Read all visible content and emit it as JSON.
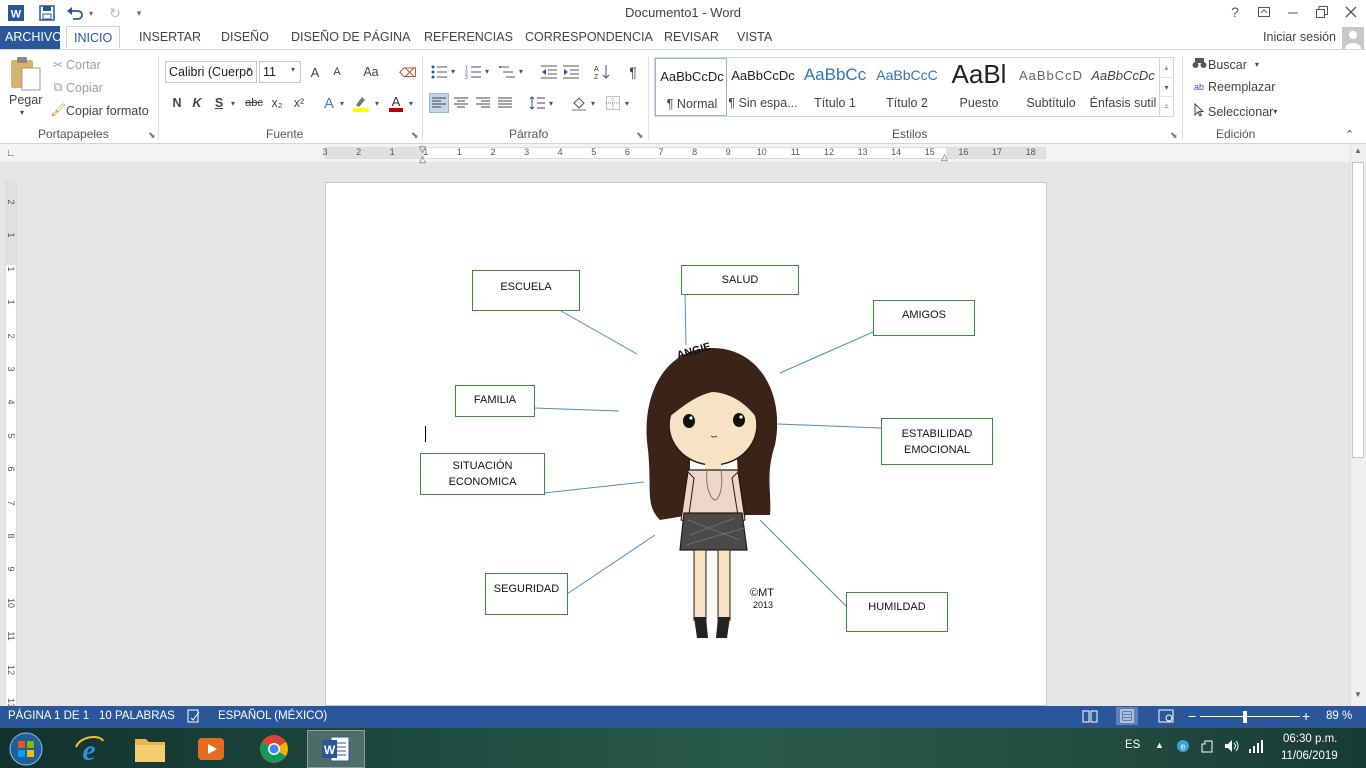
{
  "app": {
    "window_title": "Documento1 - Word"
  },
  "quick_access": {
    "word_icon": "word-app-icon",
    "save": "save-icon",
    "undo": "undo-icon",
    "redo": "redo-icon",
    "customize": "customize-qat-icon"
  },
  "window_controls": {
    "help": "?",
    "ribbon_display": "ribbon-display-icon",
    "minimize": "minimize-icon",
    "restore": "restore-icon",
    "close": "close-icon"
  },
  "tabs": [
    {
      "label": "ARCHIVO"
    },
    {
      "label": "INICIO"
    },
    {
      "label": "INSERTAR"
    },
    {
      "label": "DISEÑO"
    },
    {
      "label": "DISEÑO DE PÁGINA"
    },
    {
      "label": "REFERENCIAS"
    },
    {
      "label": "CORRESPONDENCIA"
    },
    {
      "label": "REVISAR"
    },
    {
      "label": "VISTA"
    }
  ],
  "signin": "Iniciar sesión",
  "clipboard": {
    "paste": "Pegar",
    "cut": "Cortar",
    "copy": "Copiar",
    "format_painter": "Copiar formato",
    "group": "Portapapeles"
  },
  "font": {
    "name": "Calibri (Cuerpo",
    "size": "11",
    "group": "Fuente",
    "bold": "N",
    "italic": "K",
    "underline": "S",
    "strike": "abc",
    "subscript": "x₂",
    "superscript": "x²",
    "grow": "A",
    "shrink": "A",
    "case": "Aa",
    "font_color": "#c00000",
    "highlight_color": "#ffff00"
  },
  "paragraph": {
    "group": "Párrafo",
    "pilcrow": "¶"
  },
  "styles": {
    "group": "Estilos",
    "items": [
      {
        "sample": "AaBbCcDc",
        "name": "¶ Normal"
      },
      {
        "sample": "AaBbCcDc",
        "name": "¶ Sin espa..."
      },
      {
        "sample": "AaBbCc",
        "name": "Título 1"
      },
      {
        "sample": "AaBbCcC",
        "name": "Título 2"
      },
      {
        "sample": "AaBl",
        "name": "Puesto"
      },
      {
        "sample": "AaBbCcD",
        "name": "Subtítulo"
      },
      {
        "sample": "AaBbCcDc",
        "name": "Énfasis sutil"
      }
    ]
  },
  "editing": {
    "find": "Buscar",
    "replace": "Reemplazar",
    "select": "Seleccionar",
    "group": "Edición"
  },
  "ruler": {
    "h_labels": [
      "3",
      "2",
      "1",
      "1",
      "1",
      "2",
      "3",
      "4",
      "5",
      "6",
      "7",
      "8",
      "9",
      "10",
      "11",
      "12",
      "13",
      "14",
      "15",
      "16",
      "17",
      "18"
    ],
    "v_labels": [
      "2",
      "1",
      "1",
      "1",
      "2",
      "3",
      "4",
      "5",
      "6",
      "7",
      "8",
      "9",
      "10",
      "11",
      "12",
      "13"
    ]
  },
  "diagram": {
    "boxes": {
      "escuela": "ESCUELA",
      "salud": "SALUD",
      "amigos": "AMIGOS",
      "familia": "FAMILIA",
      "estabilidad_1": "ESTABILIDAD",
      "estabilidad_2": "EMOCIONAL",
      "situacion_1": "SITUACIÓN",
      "situacion_2": "ECONOMICA",
      "seguridad": "SEGURIDAD",
      "humildad": "HUMILDAD"
    },
    "illustration": {
      "name_tag": "ANGIE",
      "signature_1": "©MT",
      "signature_2": "2013"
    },
    "line_color": "#4a90c8",
    "box_border_color": "#3a8c3a"
  },
  "status": {
    "page": "PÁGINA 1 DE 1",
    "words": "10 PALABRAS",
    "language": "ESPAÑOL (MÉXICO)",
    "zoom": "89 %",
    "zoom_value": 0.89
  },
  "taskbar": {
    "apps": [
      "start-orb-icon",
      "internet-explorer-icon",
      "file-explorer-icon",
      "media-player-icon",
      "chrome-icon",
      "word-icon"
    ],
    "lang": "ES",
    "time": "06:30 p.m.",
    "date": "11/06/2019"
  },
  "colors": {
    "word_blue": "#2b579a",
    "status_bg": "#2b579a"
  }
}
